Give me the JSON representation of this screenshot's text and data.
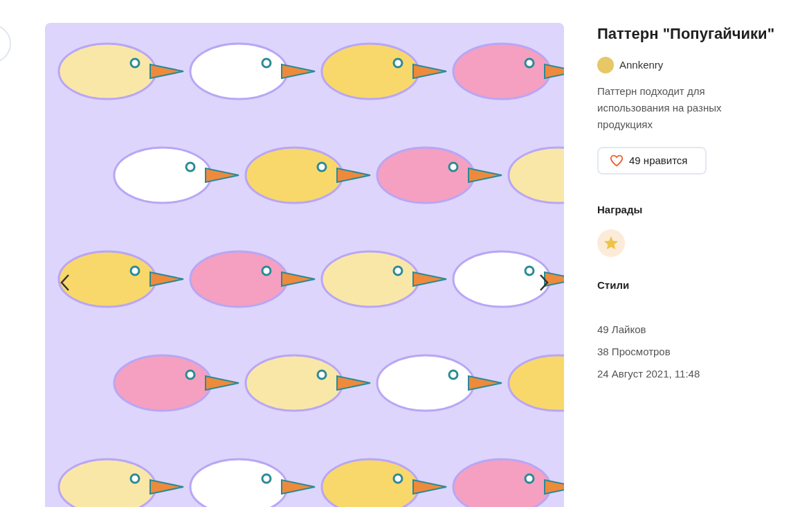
{
  "artwork": {
    "title": "Паттерн \"Попугайчики\""
  },
  "author": {
    "name": "Annkenry"
  },
  "description": "Паттерн подходит для использования на разных продукциях",
  "like_button": {
    "label": "49 нравится",
    "liked": false
  },
  "awards": {
    "heading": "Награды",
    "items": [
      {
        "kind": "star"
      }
    ]
  },
  "styles": {
    "heading": "Стили"
  },
  "stats": [
    "49 Лайков",
    "38 Просмотров",
    "24 Август 2021, 11:48"
  ]
}
